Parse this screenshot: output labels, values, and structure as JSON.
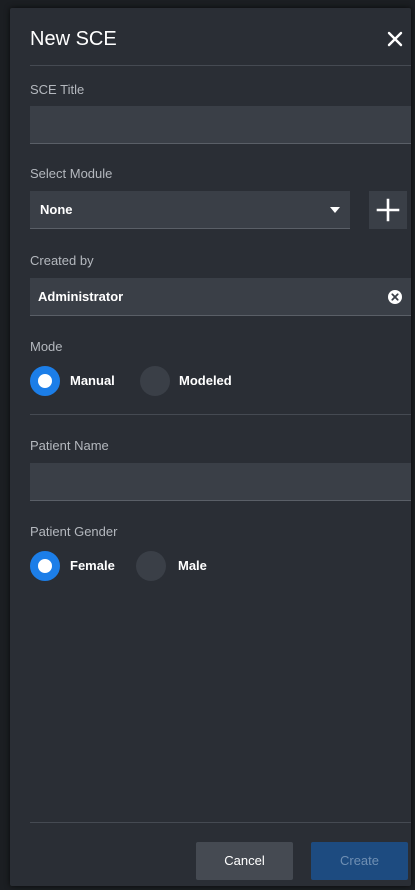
{
  "dialog": {
    "title": "New SCE"
  },
  "sce_title": {
    "label": "SCE Title",
    "value": ""
  },
  "module": {
    "label": "Select Module",
    "selected": "None"
  },
  "created_by": {
    "label": "Created by",
    "value": "Administrator"
  },
  "mode": {
    "label": "Mode",
    "options": [
      "Manual",
      "Modeled"
    ],
    "selected": "Manual"
  },
  "patient_name": {
    "label": "Patient Name",
    "value": ""
  },
  "patient_gender": {
    "label": "Patient Gender",
    "options": [
      "Female",
      "Male"
    ],
    "selected": "Female"
  },
  "footer": {
    "cancel_label": "Cancel",
    "create_label": "Create"
  },
  "colors": {
    "accent": "#1c7ee8",
    "panel": "#2a2e35",
    "field": "#3a3f47",
    "create_disabled": "#1d4b80"
  },
  "icons": {
    "close": "close-icon",
    "caret": "chevron-down-icon",
    "add": "plus-icon",
    "clear": "clear-circle-icon"
  }
}
